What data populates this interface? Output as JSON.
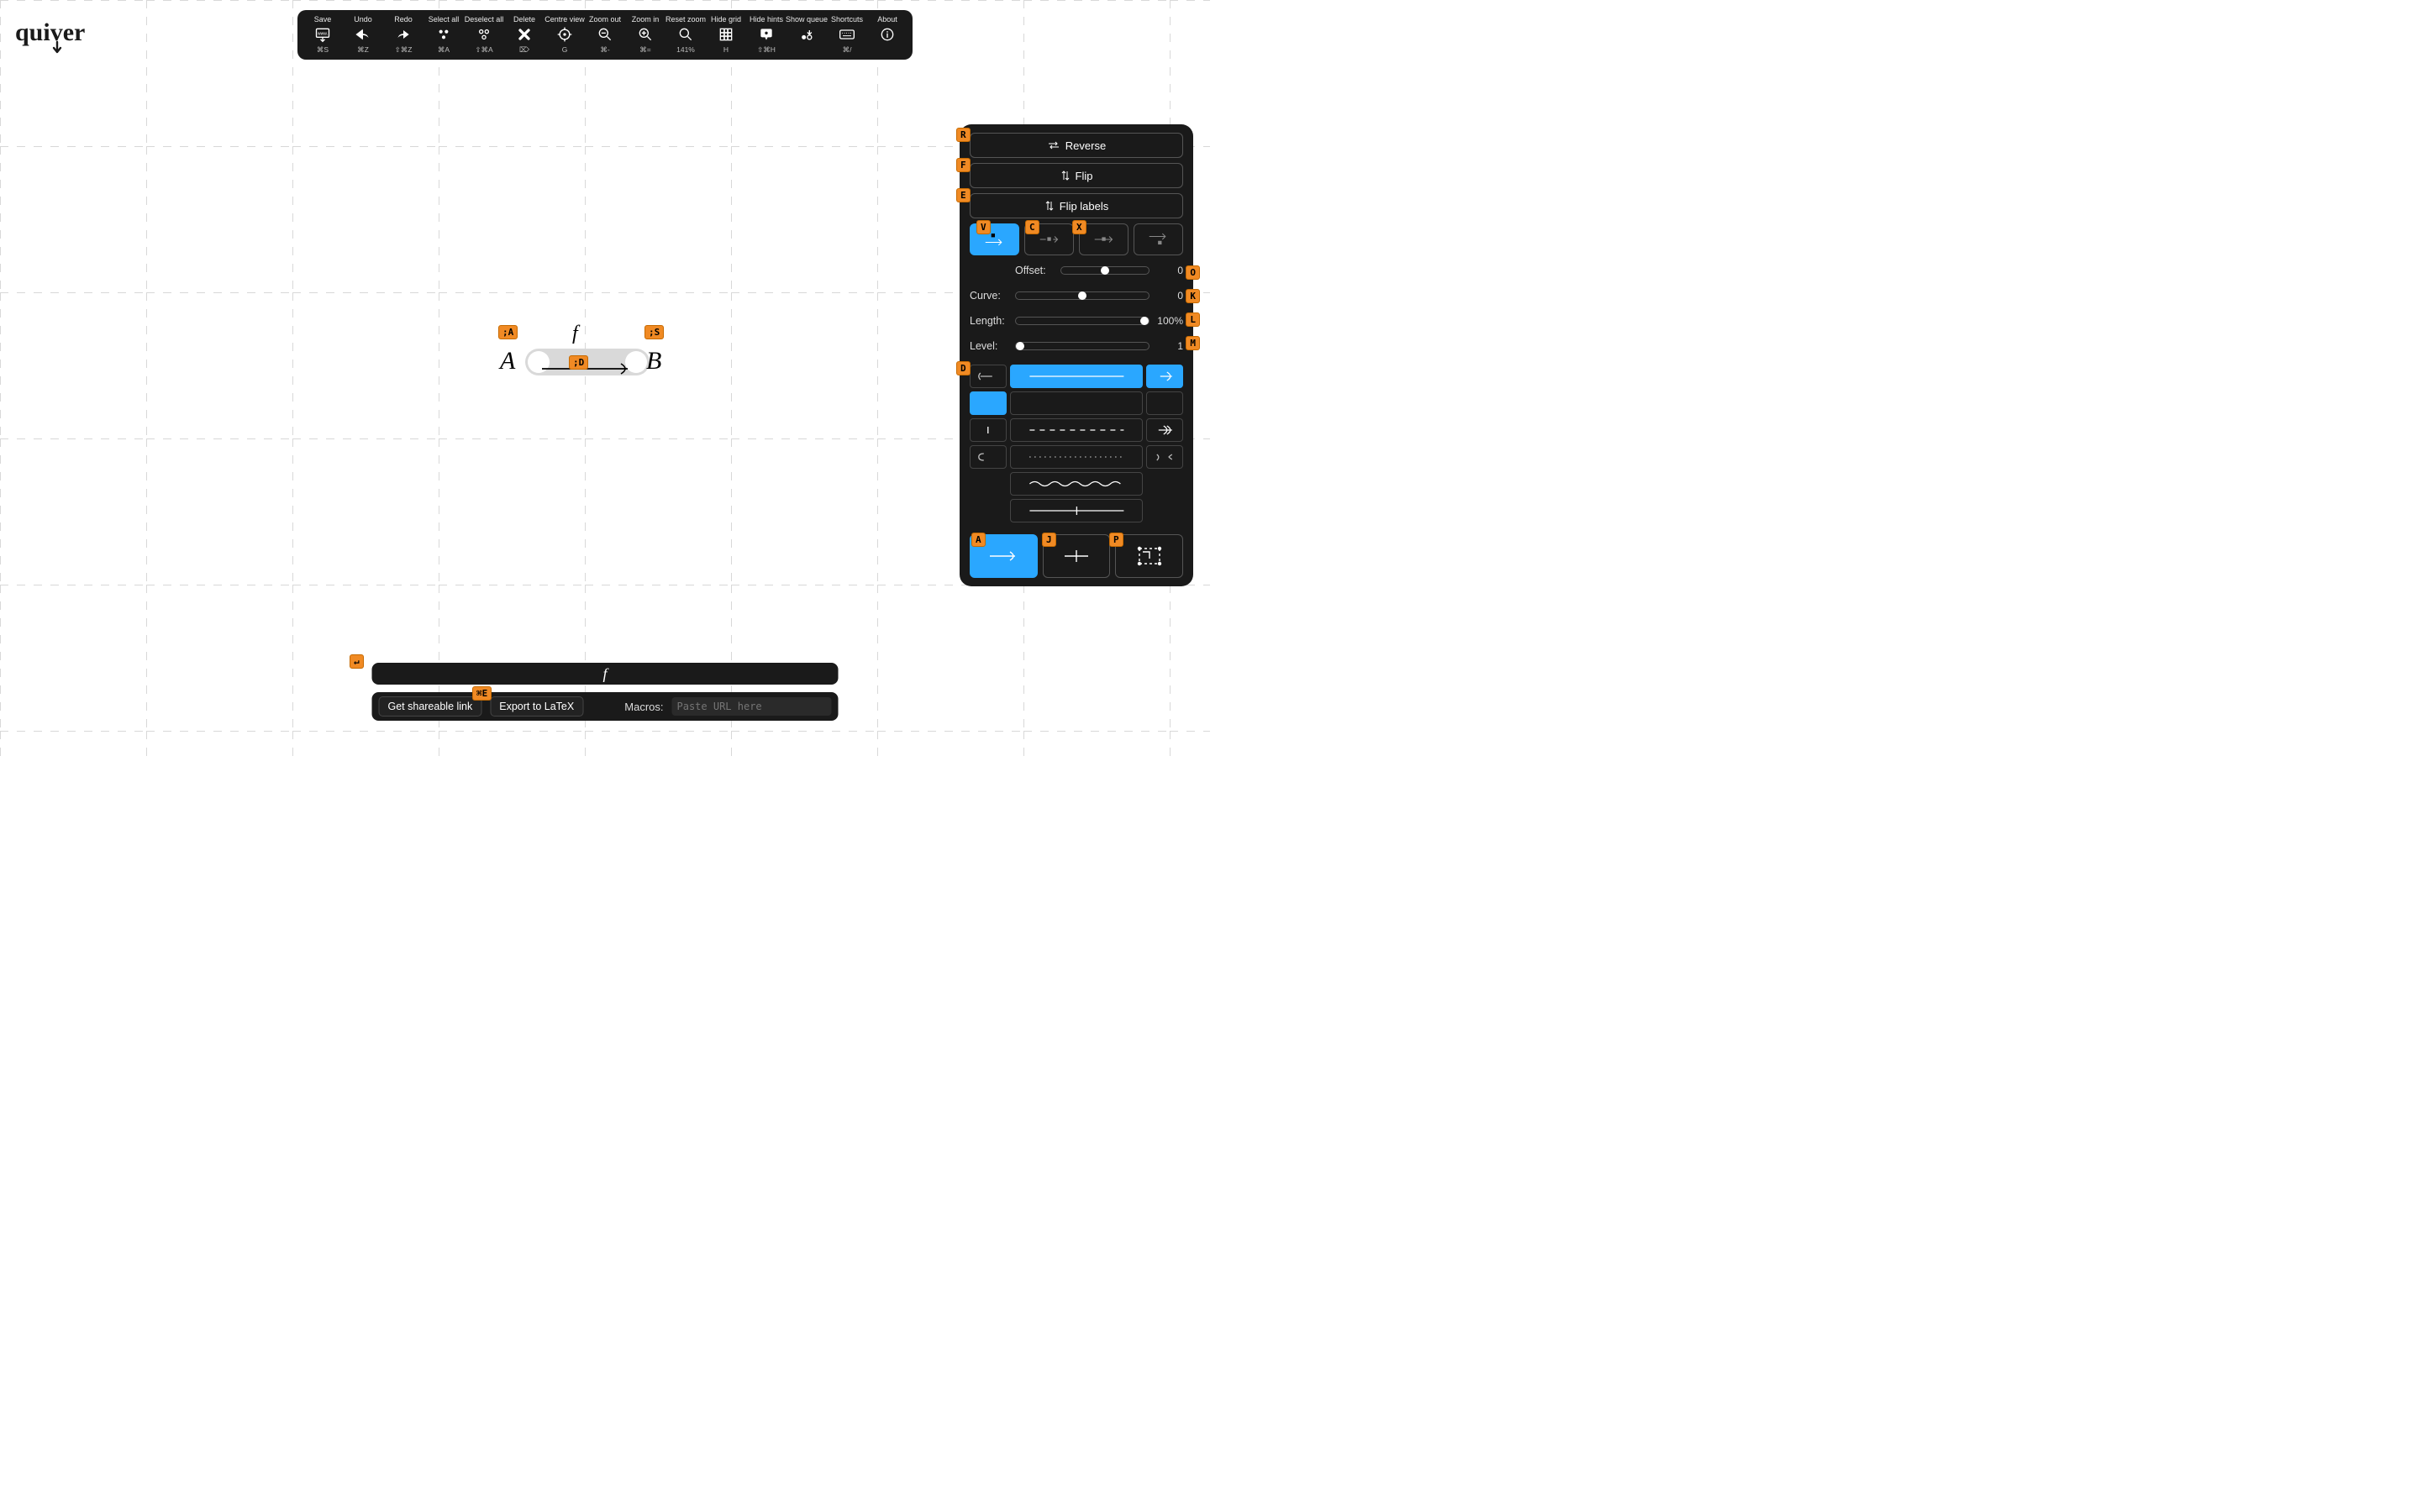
{
  "app": {
    "name": "quiver"
  },
  "toolbar": [
    {
      "label": "Save",
      "kbd": "⌘S",
      "icon": "save-icon"
    },
    {
      "label": "Undo",
      "kbd": "⌘Z",
      "icon": "undo-icon"
    },
    {
      "label": "Redo",
      "kbd": "⇧⌘Z",
      "icon": "redo-icon"
    },
    {
      "label": "Select all",
      "kbd": "⌘A",
      "icon": "select-all-icon"
    },
    {
      "label": "Deselect all",
      "kbd": "⇧⌘A",
      "icon": "deselect-all-icon"
    },
    {
      "label": "Delete",
      "kbd": "⌦",
      "icon": "delete-icon"
    },
    {
      "label": "Centre view",
      "kbd": "G",
      "icon": "centre-view-icon"
    },
    {
      "label": "Zoom out",
      "kbd": "⌘-",
      "icon": "zoom-out-icon"
    },
    {
      "label": "Zoom in",
      "kbd": "⌘=",
      "icon": "zoom-in-icon"
    },
    {
      "label": "Reset zoom",
      "kbd": "141%",
      "icon": "reset-zoom-icon"
    },
    {
      "label": "Hide grid",
      "kbd": "H",
      "icon": "hide-grid-icon"
    },
    {
      "label": "Hide hints",
      "kbd": "⇧⌘H",
      "icon": "hide-hints-icon"
    },
    {
      "label": "Show queue",
      "kbd": "",
      "icon": "show-queue-icon"
    },
    {
      "label": "Shortcuts",
      "kbd": "⌘/",
      "icon": "shortcuts-icon"
    },
    {
      "label": "About",
      "kbd": "",
      "icon": "about-icon"
    }
  ],
  "diagram": {
    "nodes": {
      "A": "A",
      "B": "B"
    },
    "edges": {
      "f": {
        "label": "f",
        "from": "A",
        "to": "B"
      }
    },
    "hints": {
      "A": ";A",
      "B": ";S",
      "edge": ";D"
    }
  },
  "sidepanel": {
    "reverse": "Reverse",
    "flip": "Flip",
    "flip_labels": "Flip labels",
    "label_pos_hints": {
      "left": "V",
      "centre": "C",
      "right": "X"
    },
    "sliders": {
      "offset": {
        "label": "Offset:",
        "value": "0",
        "hint": "O",
        "pos": 50
      },
      "curve": {
        "label": "Curve:",
        "value": "0",
        "hint": "K",
        "pos": 50
      },
      "length": {
        "label": "Length:",
        "value": "100%",
        "hint": "L",
        "pos": 100
      },
      "level": {
        "label": "Level:",
        "value": "1",
        "hint": "M",
        "pos": 0
      }
    },
    "style_hint": "D",
    "kind_hints": {
      "arrow": "A",
      "adjunction": "J",
      "pullback": "P"
    },
    "top_hints": {
      "reverse": "R",
      "flip": "F",
      "flip_labels": "E"
    }
  },
  "label_input": {
    "value": "f",
    "hint": "↵"
  },
  "bottom": {
    "share": "Get shareable link",
    "export": "Export to LaTeX",
    "export_hint": "⌘E",
    "macros_label": "Macros:",
    "macros_placeholder": "Paste URL here"
  }
}
